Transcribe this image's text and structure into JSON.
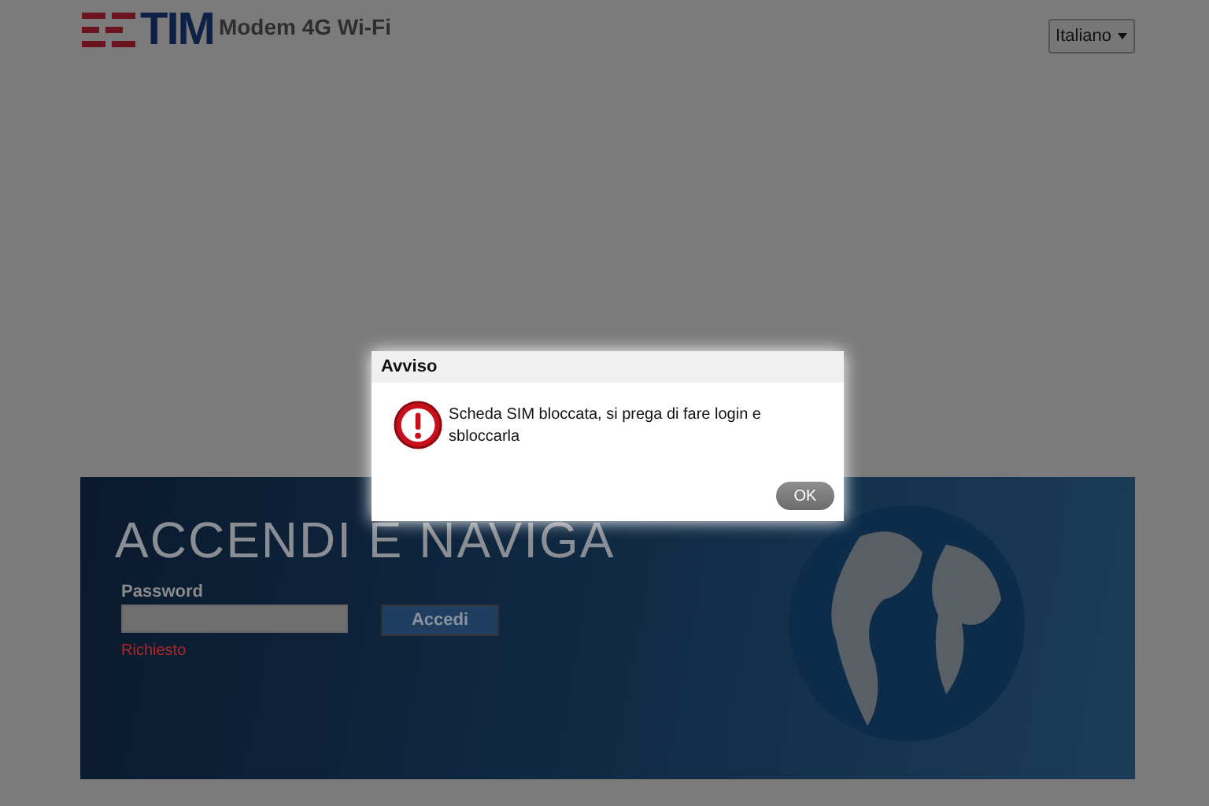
{
  "header": {
    "logo": "TIM",
    "product": "Modem 4G Wi-Fi",
    "language": "Italiano"
  },
  "banner": {
    "headline": "ACCENDI E NAVIGA",
    "password_label": "Password",
    "login_button": "Accedi",
    "required_hint": "Richiesto"
  },
  "dialog": {
    "title": "Avviso",
    "message": "Scheda SIM bloccata, si prega di fare login e sbloccarla",
    "ok_button": "OK"
  }
}
